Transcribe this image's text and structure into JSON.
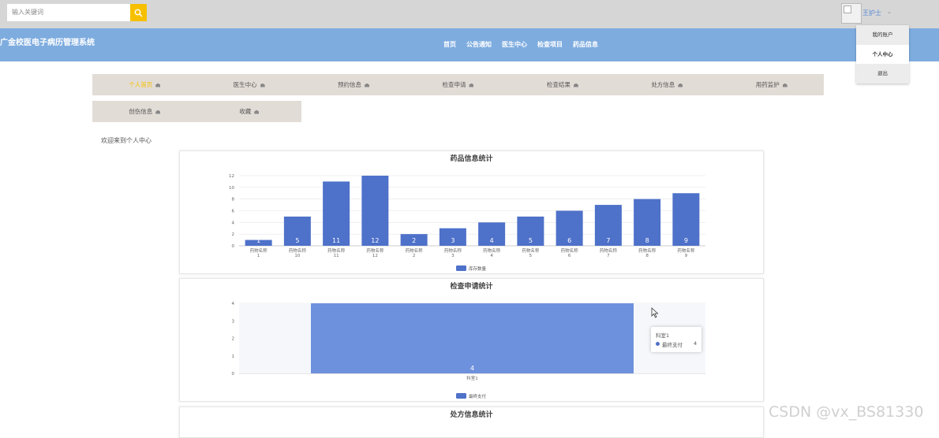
{
  "search": {
    "placeholder": "输入关键词"
  },
  "user": {
    "name": "王护士",
    "caret": "⌄"
  },
  "site": {
    "title": "广金校医电子病历管理系统"
  },
  "nav": [
    "首页",
    "公告通知",
    "医生中心",
    "检查项目",
    "药品信息"
  ],
  "dropdown": [
    "我的账户",
    "个人中心",
    "退出"
  ],
  "tabs": [
    "个人首页",
    "医生中心",
    "预约信息",
    "检查申请",
    "检查结果",
    "处方信息",
    "用药监护",
    "创伤信息",
    "收藏"
  ],
  "welcome": "欢迎来到个人中心",
  "charts": {
    "c1_title": "药品信息统计",
    "c2_title": "检查申请统计",
    "c3_title": "处方信息统计"
  },
  "tooltip": {
    "category": "科室1",
    "series": "最终支付",
    "value": "4"
  },
  "watermark": "CSDN @vx_BS81330",
  "colors": {
    "bar": "#4e71c9",
    "bar2": "#6e91dd",
    "accent": "#f6c001",
    "header": "#7eacdf"
  },
  "chart_data": [
    {
      "type": "bar",
      "title": "药品信息统计",
      "categories": [
        "药物名称1",
        "药物名称10",
        "药物名称11",
        "药物名称12",
        "药物名称2",
        "药物名称3",
        "药物名称4",
        "药物名称5",
        "药物名称6",
        "药物名称7",
        "药物名称8",
        "药物名称9"
      ],
      "series": [
        {
          "name": "库存数量",
          "values": [
            1,
            5,
            11,
            12,
            2,
            3,
            4,
            5,
            6,
            7,
            8,
            9
          ]
        }
      ],
      "ylim": [
        0,
        12
      ],
      "yticks": [
        0,
        2,
        4,
        6,
        8,
        10,
        12
      ],
      "grid": true,
      "legend": "bottom"
    },
    {
      "type": "bar",
      "title": "检查申请统计",
      "categories": [
        "科室1"
      ],
      "series": [
        {
          "name": "最终支付",
          "values": [
            4
          ]
        }
      ],
      "ylim": [
        0,
        4
      ],
      "yticks": [
        0,
        1,
        2,
        3,
        4
      ],
      "grid": true,
      "legend": "bottom"
    }
  ]
}
